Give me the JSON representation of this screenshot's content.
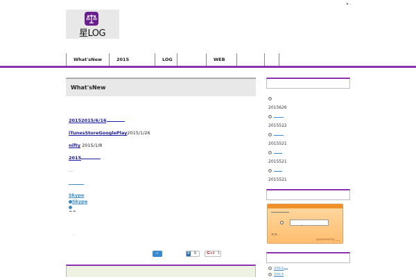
{
  "header": {
    "top_link": "▸ .",
    "logo_text": "星LOG"
  },
  "nav": {
    "items": [
      "What'sNew",
      "2015",
      "LOG",
      "",
      "WEB",
      "",
      ""
    ]
  },
  "main": {
    "title": "What'sNew",
    "posts": [
      {
        "link": "20152015/6/16",
        "tail": ""
      },
      {
        "link": "iTunesStoreGooglePlay",
        "tail": "2015/1/26"
      },
      {
        "link": "nifty",
        "tail": " 2015/1/8"
      },
      {
        "link": "2015",
        "tail": ""
      }
    ],
    "ellipsis": "...",
    "more_link": "",
    "skype_link": "Skype",
    "skype_status": "Skype",
    "smile": "^^",
    "small_mark": "."
  },
  "share": {
    "tweet_label": "✓",
    "hatena_count": "0",
    "gplus_label": "G+I",
    "gplus_count": "1"
  },
  "sidebar": {
    "items": [
      {
        "date": "2015626",
        "bullet": true
      },
      {
        "date": "2015522",
        "bullet": true
      },
      {
        "date": "2015521",
        "bullet": true
      },
      {
        "date": "2015521",
        "bullet": true
      },
      {
        "date": "2015521",
        "bullet": false
      }
    ],
    "widget": {
      "text": ">> .",
      "powered": "powered by ___"
    },
    "archives": [
      "2012",
      "2013"
    ]
  },
  "colors": {
    "accent": "#8a2fb0",
    "link": "#1a1aa8",
    "link_light": "#3a8ad0",
    "widget_orange": "#f0902a"
  }
}
